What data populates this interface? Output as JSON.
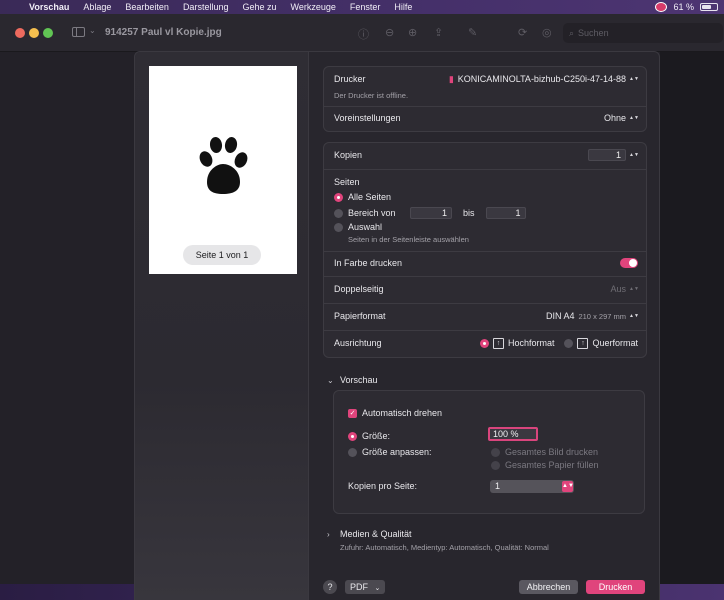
{
  "menubar": {
    "app_name": "Vorschau",
    "items": [
      "Ablage",
      "Bearbeiten",
      "Darstellung",
      "Gehe zu",
      "Werkzeuge",
      "Fenster",
      "Hilfe"
    ],
    "battery_text": "61 %",
    "battery_level": 0.61
  },
  "window": {
    "title": "914257 Paul vl Kopie.jpg",
    "search_placeholder": "Suchen"
  },
  "preview": {
    "page_label": "Seite 1 von 1"
  },
  "printer": {
    "label": "Drucker",
    "value": "KONICAMINOLTA-bizhub-C250i-47-14-88",
    "status": "Der Drucker ist offline.",
    "presets_label": "Voreinstellungen",
    "presets_value": "Ohne"
  },
  "copies": {
    "label": "Kopien",
    "value": "1"
  },
  "pages": {
    "label": "Seiten",
    "all_label": "Alle Seiten",
    "range_label": "Bereich von",
    "range_from": "1",
    "range_to_label": "bis",
    "range_to": "1",
    "selection_label": "Auswahl",
    "selection_hint": "Seiten in der Seitenleiste auswählen"
  },
  "options": {
    "color_label": "In Farbe drucken",
    "duplex_label": "Doppelseitig",
    "duplex_value": "Aus",
    "paper_label": "Papierformat",
    "paper_value": "DIN A4",
    "paper_size": "210 x 297 mm",
    "orientation_label": "Ausrichtung",
    "portrait_label": "Hochformat",
    "landscape_label": "Querformat"
  },
  "vorschau": {
    "header": "Vorschau",
    "auto_rotate_label": "Automatisch drehen",
    "size_label": "Größe:",
    "size_value": "100 %",
    "fit_label": "Größe anpassen:",
    "fit_image_label": "Gesamtes Bild drucken",
    "fit_paper_label": "Gesamtes Papier füllen",
    "pages_per_sheet_label": "Kopien pro Seite:",
    "pages_per_sheet_value": "1"
  },
  "media": {
    "header": "Medien & Qualität",
    "summary": "Zufuhr: Automatisch, Medientyp: Automatisch, Qualität: Normal"
  },
  "footer": {
    "help_label": "?",
    "pdf_label": "PDF",
    "cancel_label": "Abbrechen",
    "print_label": "Drucken"
  },
  "colors": {
    "accent": "#e0447c"
  }
}
